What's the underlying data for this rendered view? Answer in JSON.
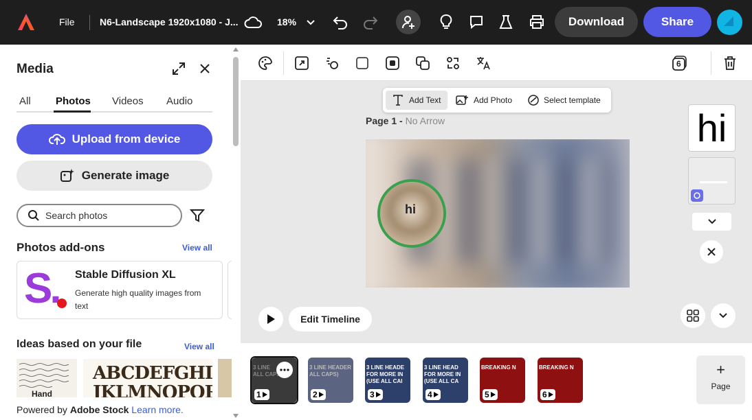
{
  "topbar": {
    "file_label": "File",
    "doc_title": "N6-Landscape 1920x1080 - J...",
    "zoom": "18%",
    "download_label": "Download",
    "share_label": "Share"
  },
  "panel": {
    "title": "Media",
    "tabs": [
      "All",
      "Photos",
      "Videos",
      "Audio"
    ],
    "active_tab": "Photos",
    "upload_label": "Upload from device",
    "generate_label": "Generate image",
    "search_placeholder": "Search photos",
    "addons_title": "Photos add-ons",
    "view_all": "View all",
    "addon": {
      "name": "Stable Diffusion XL",
      "desc": "Generate high quality images from text",
      "logo_letter": "S."
    },
    "ideas_title": "Ideas based on your file",
    "idea_words": [
      "Hand",
      "ABCDEFGHI",
      "JKLMNOPQR"
    ],
    "footer_prefix": "Powered by ",
    "footer_brand": "Adobe Stock",
    "footer_link": "Learn more."
  },
  "canvas": {
    "quick_actions": [
      "Add Text",
      "Add Photo",
      "Select template"
    ],
    "page_label": "Page 1 - ",
    "page_subtitle": "No Arrow",
    "lens_text": "hi",
    "side_preview_text": "hi",
    "edit_timeline": "Edit Timeline",
    "layers_count": "6"
  },
  "filmstrip": {
    "pages": [
      {
        "n": "1",
        "lines": [
          "3 LINE",
          "ALL CAPS"
        ],
        "bg": "#3a3a3a",
        "accent": "#888"
      },
      {
        "n": "2",
        "lines": [
          "3 LINE HEADER",
          "ALL CAPS)"
        ],
        "bg": "#5b6480",
        "accent": "#bbb"
      },
      {
        "n": "3",
        "lines": [
          "3 LINE HEADE",
          "FOR MORE IN",
          "(USE ALL CAI"
        ],
        "bg": "#2d3f6b",
        "accent": "#fff"
      },
      {
        "n": "4",
        "lines": [
          "3 LINE HEAD",
          "FOR MORE IN",
          "(USE ALL CA"
        ],
        "bg": "#2d3f6b",
        "accent": "#fff"
      },
      {
        "n": "5",
        "lines": [
          "BREAKING N"
        ],
        "bg": "#8f1010",
        "accent": "#fff"
      },
      {
        "n": "6",
        "lines": [
          "BREAKING N"
        ],
        "bg": "#8f1010",
        "accent": "#fff"
      }
    ],
    "add_page_label": "Page"
  },
  "colors": {
    "accent": "#5258e4",
    "topbar": "#1e1e1e",
    "addon_logo": "#9b3bd9",
    "addon_dot": "#e3171c"
  }
}
